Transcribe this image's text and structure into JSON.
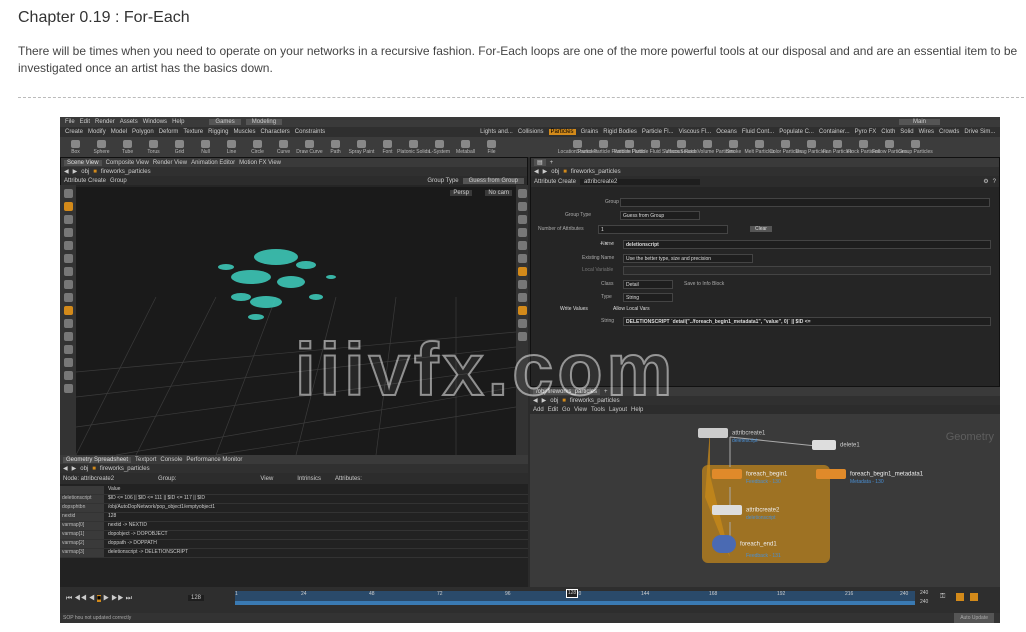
{
  "article": {
    "title": "Chapter 0.19 : For-Each",
    "description": "There will be times when you need to operate on your networks in a recursive fashion. For-Each loops are one of the more powerful tools at our disposal and and are an essential item to be investigated once an artist has the basics down."
  },
  "app": {
    "menu": [
      "File",
      "Edit",
      "Render",
      "Assets",
      "Windows",
      "Help"
    ],
    "desktop": "Games",
    "workspace": "Modeling",
    "user": "Main",
    "shelf_left": [
      "Create",
      "Modify",
      "Model",
      "Polygon",
      "Deform",
      "Texture",
      "Rigging",
      "Muscles",
      "Characters",
      "Constraints"
    ],
    "shelf_right": [
      "Lights and...",
      "Collisions",
      "Particles",
      "Grains",
      "Rigid Bodies",
      "Particle Fl...",
      "Viscous Fl...",
      "Oceans",
      "Fluid Cont...",
      "Populate C...",
      "Container...",
      "Pyro FX",
      "Cloth",
      "Solid",
      "Wires",
      "Crowds",
      "Drive Sim..."
    ],
    "tools_left": [
      "Box",
      "Sphere",
      "Tube",
      "Torus",
      "Grid",
      "Null",
      "Line",
      "Circle",
      "Curve",
      "Draw Curve",
      "Path",
      "Spray Paint",
      "Font",
      "Platonic Solids",
      "L-System",
      "Metaball",
      "File"
    ],
    "tools_right": [
      "Location Particles",
      "Source Particle Particles",
      "Particle Fluids",
      "Particle Fluid Surface",
      "Viscous Fluids",
      "Source Volume Particles",
      "Smoke",
      "Melt Particles",
      "Color Particles",
      "Drag Particles",
      "Fan Particles",
      "Flock Particles",
      "Follow Particles",
      "Group Particles"
    ],
    "left_tabs": [
      "Scene View",
      "Composite View",
      "Render View",
      "Animation Editor",
      "Motion FX View"
    ],
    "path_obj": "obj",
    "path_node": "fireworks_particles",
    "vp_node": "Attribute Create",
    "vp_node_name": "Group",
    "group_type_label": "Group Type",
    "group_type_value": "Guess from Group",
    "persp": "Persp",
    "cam": "No cam",
    "param_type": "Attribute Create",
    "param_name": "attribcreate2",
    "rows": {
      "group": "Group",
      "group_type": "Group Type",
      "group_type_val": "Guess from Group",
      "num_attrs": "Number of Attributes",
      "num_attrs_val": "1",
      "clear": "Clear",
      "name_lbl": "Name",
      "name_val": "deletionscript",
      "existing_lbl": "Existing Name",
      "existing_val": "Use the better type, size and precision",
      "local_lbl": "Local Variable",
      "class_lbl": "Class",
      "class_val": "Detail",
      "save_info": "Save to Info Block",
      "type_lbl": "Type",
      "type_val": "String",
      "write_values": "Write Values",
      "allow_local": "Allow Local Vars",
      "string_lbl": "String",
      "string_val": "DELETIONSCRIPT `detail(\"../foreach_begin1_metadata1\", \"value\", 0)` || $ID <="
    },
    "ne_tab": "/obj/fireworks_particles",
    "ne_menu": [
      "Add",
      "Edit",
      "Go",
      "View",
      "Tools",
      "Layout",
      "Help"
    ],
    "geometry_label": "Geometry",
    "nodes": [
      {
        "name": "attribcreate1",
        "sub": "deletescript"
      },
      {
        "name": "delete1",
        "sub": ""
      },
      {
        "name": "foreach_begin1",
        "sub": "Feedback - 130"
      },
      {
        "name": "foreach_begin1_metadata1",
        "sub": "Metadata - 130"
      },
      {
        "name": "attribcreate2",
        "sub": "deletionscript"
      },
      {
        "name": "foreach_end1",
        "sub": "Feedback - 131"
      }
    ],
    "ss_tabs": [
      "Geometry Spreadsheet",
      "Textport",
      "Console",
      "Performance Monitor"
    ],
    "ss_node": "Node: attribcreate2",
    "ss_group": "Group:",
    "ss_view": "View",
    "ss_intrinsics": "Intrinsics",
    "ss_attributes": "Attributes:",
    "ss_header": "Value",
    "ss_rows": [
      {
        "k": "deletionscript",
        "v": "$ID <= 106 || $ID <= 111 || $ID <= 117 || $ID"
      },
      {
        "k": "dopsphtbn",
        "v": "/obj/AutoDopNetwork/pop_object1/emptyobject1"
      },
      {
        "k": "nextid",
        "v": "128"
      },
      {
        "k": "varmap[0]",
        "v": "nextid -> NEXTID"
      },
      {
        "k": "varmap[1]",
        "v": "dopobject -> DOPOBJECT"
      },
      {
        "k": "varmap[2]",
        "v": "doppath -> DOPPATH"
      },
      {
        "k": "varmap[3]",
        "v": "deletionscript -> DELETIONSCRIPT"
      }
    ],
    "frame": "128",
    "frame_end": "240",
    "frame_end2": "240",
    "ticks": [
      "1",
      "24",
      "48",
      "72",
      "96",
      "120",
      "144",
      "168",
      "192",
      "216",
      "240"
    ],
    "status": "SOP hou not updated correctly",
    "auto_update": "Auto Update",
    "watermark": "iiivfx.com",
    "accent": "#d38a1a",
    "blue": "#4a8fd3"
  }
}
